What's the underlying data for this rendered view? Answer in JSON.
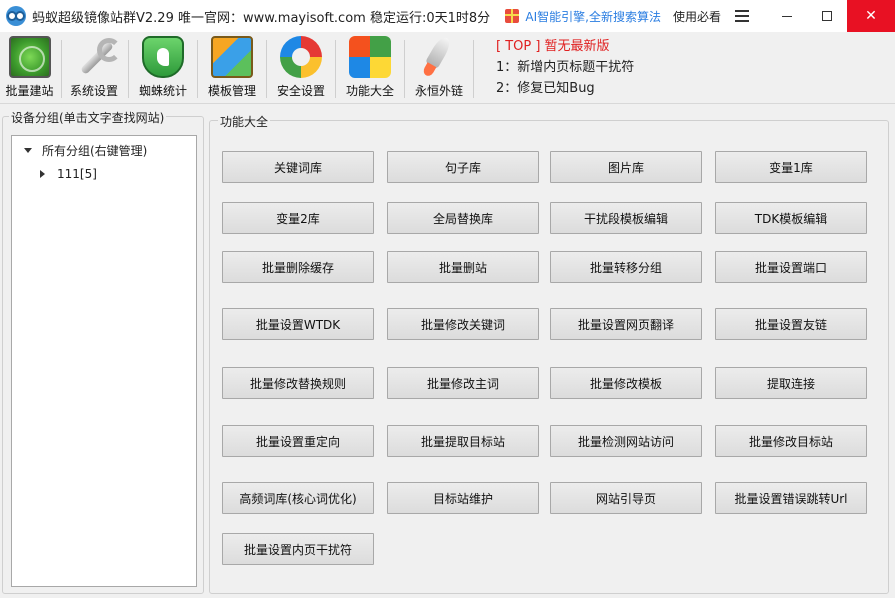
{
  "window": {
    "title": "蚂蚁超级镜像站群V2.29 唯一官网：www.mayisoft.com 稳定运行:0天1时8分",
    "ai_link": "AI智能引擎,全新搜索算法",
    "help_link": "使用必看",
    "minimize": "—",
    "maximize": "☐",
    "close": "✕"
  },
  "toolbar": {
    "items": [
      {
        "label": "批量建站",
        "icon": "radar-icon"
      },
      {
        "label": "系统设置",
        "icon": "wrench-icon"
      },
      {
        "label": "蜘蛛统计",
        "icon": "spider-shield-icon"
      },
      {
        "label": "模板管理",
        "icon": "template-icon"
      },
      {
        "label": "安全设置",
        "icon": "safety-icon"
      },
      {
        "label": "功能大全",
        "icon": "functions-icon"
      },
      {
        "label": "永恒外链",
        "icon": "rocket-icon"
      }
    ],
    "notice": {
      "line1": "[ TOP ] 暂无最新版",
      "line2": "1：新增内页标题干扰符",
      "line3": "2：修复已知Bug"
    }
  },
  "left_panel": {
    "caption": "设备分组(单击文字查找网站)",
    "tree": {
      "root": "所有分组(右键管理)",
      "child": "111[5]"
    }
  },
  "right_panel": {
    "caption": "功能大全",
    "buttons": [
      "关键词库",
      "句子库",
      "图片库",
      "变量1库",
      "变量2库",
      "全局替换库",
      "干扰段模板编辑",
      "TDK模板编辑",
      "批量删除缓存",
      "批量删站",
      "批量转移分组",
      "批量设置端口",
      "批量设置WTDK",
      "批量修改关键词",
      "批量设置网页翻译",
      "批量设置友链",
      "批量修改替换规则",
      "批量修改主词",
      "批量修改模板",
      "提取连接",
      "批量设置重定向",
      "批量提取目标站",
      "批量检测网站访问",
      "批量修改目标站",
      "高频词库(核心词优化)",
      "目标站维护",
      "网站引导页",
      "批量设置错误跳转Url",
      "批量设置内页干扰符"
    ]
  }
}
